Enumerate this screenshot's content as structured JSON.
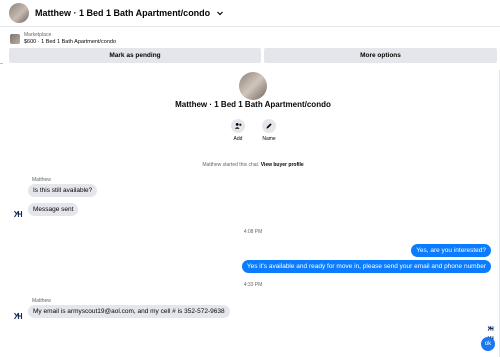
{
  "header": {
    "title": "Matthew · 1 Bed 1 Bath Apartment/condo"
  },
  "listing": {
    "kicker": "Marketplace",
    "title": "$600 · 1 Bed 1 Bath Apartment/condo"
  },
  "actions": {
    "mark_pending": "Mark as pending",
    "more_options": "More options"
  },
  "profile": {
    "name": "Matthew · 1 Bed 1 Bath Apartment/condo",
    "add_label": "Add",
    "name_label": "Name"
  },
  "system_note": {
    "text": "Matthew started this chat.",
    "link": "View buyer profile"
  },
  "messages": {
    "sender_1": "Matthew",
    "in_1": "Is this still available?",
    "in_2": "Message sent",
    "time_1": "4:08 PM",
    "out_1": "Yes, are you interested?",
    "out_2": "Yes it's available and ready for move in, please send your email and phone number",
    "time_2": "4:33 PM",
    "sender_2": "Matthew",
    "in_3": "My email is armyscout19@aol.com, and my cell # is 352-572-9638"
  },
  "quick_reply": {
    "label": "ok"
  },
  "colors": {
    "accent": "#0a7cff",
    "bubble_in": "#e4e6eb",
    "button_bg": "#e4e6eb",
    "muted_text": "#65676b",
    "ok_button": "#1877f2"
  },
  "icons": {
    "header_chevron": "chevron-down-icon",
    "add": "add-person-icon",
    "name": "pencil-icon",
    "avatar": "ny-logo-icon"
  }
}
